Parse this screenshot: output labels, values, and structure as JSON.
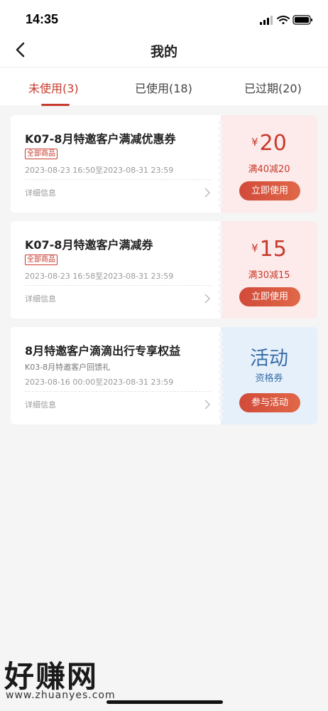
{
  "status_bar": {
    "time": "14:35"
  },
  "nav": {
    "title": "我的"
  },
  "tabs": [
    {
      "label": "未使用(3)",
      "active": true
    },
    {
      "label": "已使用(18)",
      "active": false
    },
    {
      "label": "已过期(20)",
      "active": false
    }
  ],
  "coupons": [
    {
      "title": "K07-8月特邀客户满减优惠券",
      "tag": "全部商品",
      "date_range": "2023-08-23 16:50至2023-08-31 23:59",
      "details_label": "详细信息",
      "currency": "¥",
      "amount": "20",
      "condition": "满40减20",
      "button_label": "立即使用"
    },
    {
      "title": "K07-8月特邀客户满减券",
      "tag": "全部商品",
      "date_range": "2023-08-23 16:58至2023-08-31 23:59",
      "details_label": "详细信息",
      "currency": "¥",
      "amount": "15",
      "condition": "满30减15",
      "button_label": "立即使用"
    },
    {
      "title": "8月特邀客户滴滴出行专享权益",
      "subtitle": "K03-8月特邀客户回馈礼",
      "date_range": "2023-08-16 00:00至2023-08-31 23:59",
      "details_label": "详细信息",
      "side_title": "活动",
      "side_subtitle": "资格券",
      "button_label": "参与活动"
    }
  ],
  "watermark": {
    "text": "好赚网",
    "url": "www.zhuanyes.com"
  },
  "colors": {
    "accent": "#c73a2c",
    "activity_blue": "#3a6ea8",
    "coupon_bg_red": "#fcebea",
    "coupon_bg_blue": "#e6f0fb"
  }
}
